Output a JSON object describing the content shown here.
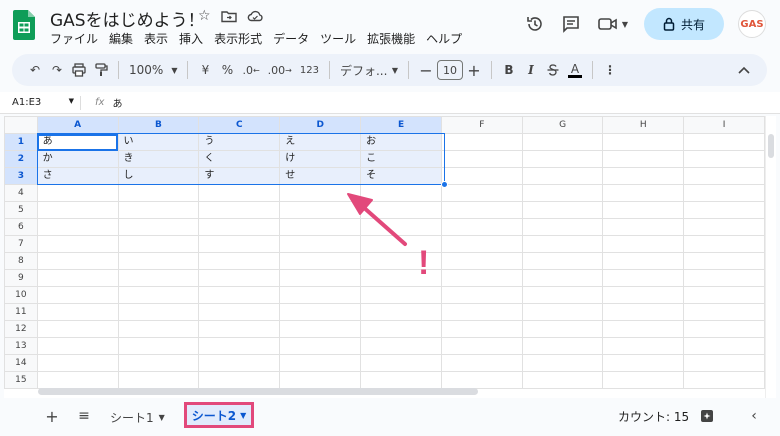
{
  "app": {
    "title": "GASをはじめよう！",
    "menus": [
      "ファイル",
      "編集",
      "表示",
      "挿入",
      "表示形式",
      "データ",
      "ツール",
      "拡張機能",
      "ヘルプ"
    ],
    "share_label": "共有",
    "avatar_text": "GAS"
  },
  "toolbar": {
    "zoom": "100%",
    "currency": "¥",
    "percent": "%",
    "dec_decrease": ".0",
    "dec_increase": ".00",
    "number_format": "123",
    "font": "デフォ...",
    "font_size": "10",
    "bold": "B",
    "italic": "I",
    "text_color": "A"
  },
  "formula_bar": {
    "name_box": "A1:E3",
    "fx": "fx",
    "content": "あ"
  },
  "sheet": {
    "columns": [
      "A",
      "B",
      "C",
      "D",
      "E",
      "F",
      "G",
      "H",
      "I"
    ],
    "selected_columns": [
      "A",
      "B",
      "C",
      "D",
      "E"
    ],
    "rows": [
      [
        "あ",
        "い",
        "う",
        "え",
        "お",
        "",
        "",
        "",
        ""
      ],
      [
        "か",
        "き",
        "く",
        "け",
        "こ",
        "",
        "",
        "",
        ""
      ],
      [
        "さ",
        "し",
        "す",
        "せ",
        "そ",
        "",
        "",
        "",
        ""
      ]
    ],
    "row_count": 15
  },
  "annotation": {
    "mark": "!",
    "color": "#e2497b"
  },
  "bottom": {
    "tabs": [
      {
        "label": "シート1",
        "active": false
      },
      {
        "label": "シート2",
        "active": true
      }
    ],
    "count_label": "カウント: 15"
  },
  "colors": {
    "accent": "#1a73e8",
    "share_bg": "#c2e7ff",
    "highlight": "#e2497b"
  }
}
